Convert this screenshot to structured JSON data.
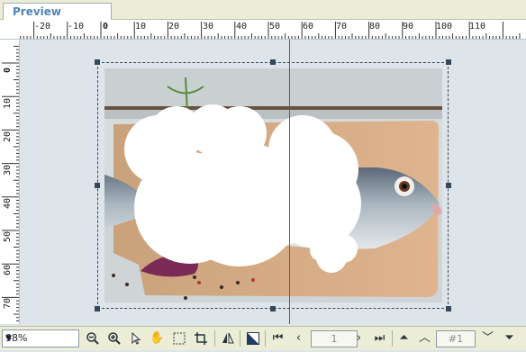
{
  "tab": {
    "label": "Preview"
  },
  "ruler": {
    "h_labels": [
      "-20",
      "-10",
      "0",
      "10",
      "20",
      "30",
      "40",
      "50",
      "60",
      "70",
      "80",
      "90",
      "100",
      "110"
    ],
    "v_labels": [
      "0",
      "10",
      "20",
      "30",
      "40",
      "50",
      "60",
      "70"
    ]
  },
  "toolbar": {
    "zoom_value": "98%",
    "page_number": "1",
    "frame_number": "#1"
  },
  "icons": [
    "zoom-out-icon",
    "zoom-in-icon",
    "pointer-icon",
    "hand-icon",
    "selection-rect-icon",
    "crop-icon",
    "flip-icon",
    "fill-icon",
    "first-page-icon",
    "prev-page-icon",
    "next-page-icon",
    "last-page-icon",
    "first-frame-icon",
    "prev-frame-icon",
    "next-frame-icon",
    "last-frame-icon"
  ]
}
